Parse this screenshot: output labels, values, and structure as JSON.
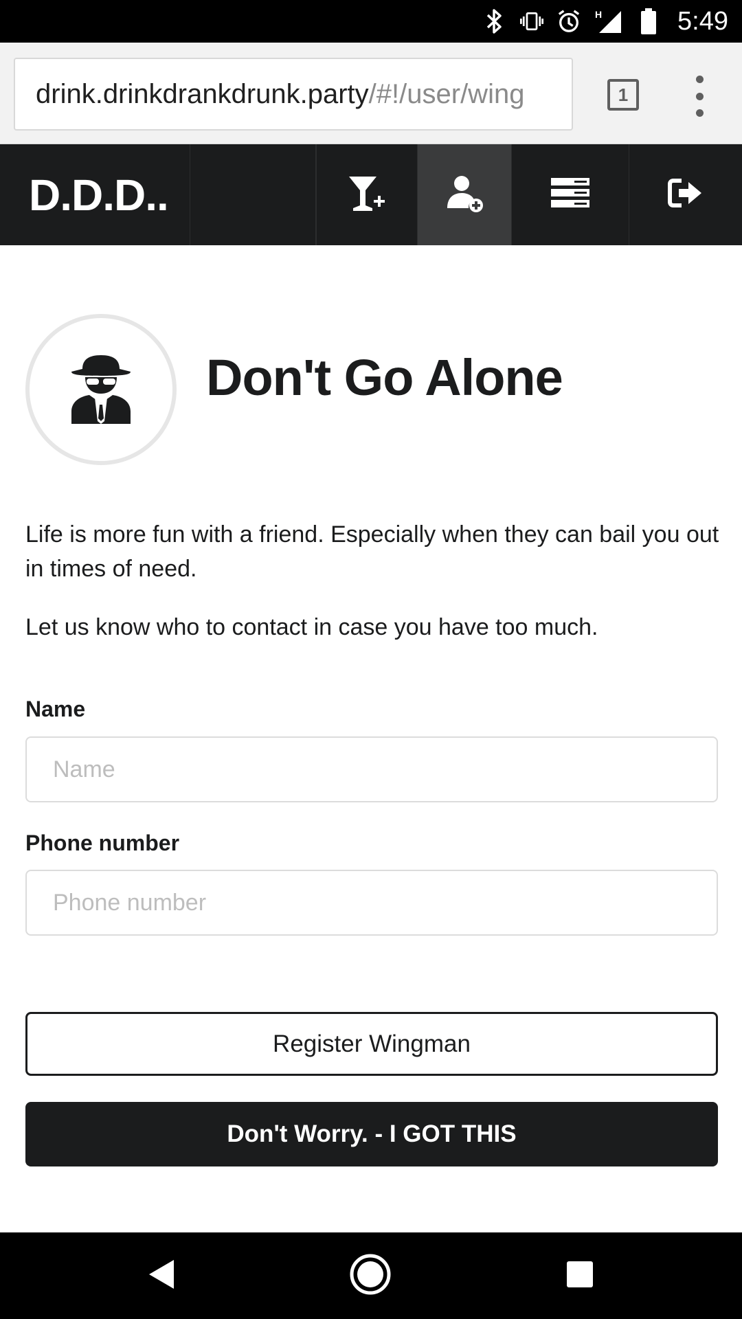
{
  "status_bar": {
    "time": "5:49",
    "icons": [
      "bluetooth-icon",
      "vibrate-icon",
      "alarm-icon",
      "signal-icon",
      "battery-icon"
    ],
    "network_type": "H"
  },
  "browser": {
    "url_host": "drink.drinkdrankdrunk.party",
    "url_path": "/#!/user/wing",
    "tab_count": "1"
  },
  "menu": {
    "brand": "D.D.D..",
    "items": [
      {
        "icon": "add-drink-icon",
        "active": false
      },
      {
        "icon": "add-user-icon",
        "active": true
      },
      {
        "icon": "list-icon",
        "active": false
      },
      {
        "icon": "sign-out-icon",
        "active": false
      }
    ]
  },
  "page": {
    "avatar_icon": "spy-icon",
    "title": "Don't Go Alone",
    "paragraph_1": "Life is more fun with a friend. Especially when they can bail you out in times of need.",
    "paragraph_2": "Let us know who to contact in case you have too much."
  },
  "form": {
    "name_label": "Name",
    "name_placeholder": "Name",
    "phone_label": "Phone number",
    "phone_placeholder": "Phone number",
    "register_button": "Register Wingman",
    "skip_button": "Don't Worry. - I GOT THIS"
  },
  "colors": {
    "menu_background": "#1b1c1d",
    "menu_active": "#3a3b3c",
    "primary_button": "#1b1c1d",
    "input_border": "#dcdcdc"
  }
}
